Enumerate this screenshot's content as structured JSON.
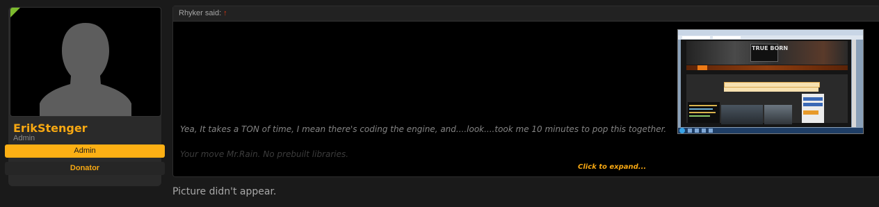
{
  "user": {
    "username": "ErikStenger",
    "title": "Admin",
    "banners": [
      "Admin",
      "Donator"
    ]
  },
  "quote": {
    "author": "Rhyker said:",
    "jump_icon": "↑",
    "text": "Yea, It takes a TON of time, I mean there's coding the engine, and....look....took me 10 minutes to pop this together.",
    "text_faded": "Your move Mr.Rain. No prebuilt libraries.",
    "expand_label": "Click to expand...",
    "embedded_logo": "TRUE BORN"
  },
  "reply": {
    "text": "Picture didn't appear."
  },
  "colors": {
    "accent_orange": "#f7a812",
    "admin_banner": "#fdb014",
    "jump_arrow": "#e0380f",
    "online_indicator": "#7dbb2e"
  },
  "icons": {
    "avatar": "default-avatar-silhouette",
    "jump": "up-arrow-icon",
    "online": "online-indicator-icon"
  }
}
